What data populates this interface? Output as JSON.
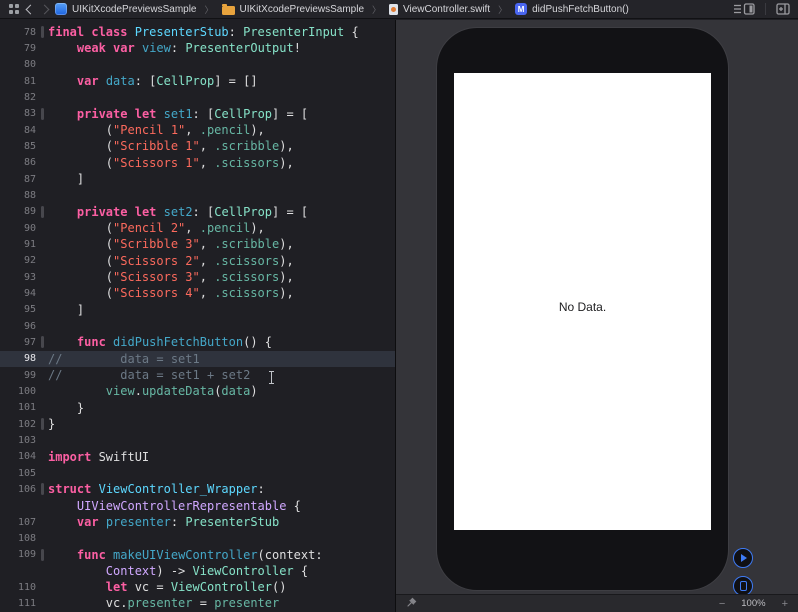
{
  "jump_bar": {
    "breadcrumbs": [
      {
        "label": "UIKitXcodePreviewsSample",
        "icon": "project-icon"
      },
      {
        "label": "UIKitXcodePreviewsSample",
        "icon": "folder-icon"
      },
      {
        "label": "ViewController.swift",
        "icon": "swift-file-icon"
      },
      {
        "label": "didPushFetchButton()",
        "icon": "method-icon",
        "badge": "M"
      }
    ],
    "separator": "〉"
  },
  "editor": {
    "current_line": 98,
    "rows": [
      {
        "n": 78,
        "mark": true,
        "t": [
          [
            "k",
            "final"
          ],
          [
            "p",
            " "
          ],
          [
            "k",
            "class"
          ],
          [
            "p",
            " "
          ],
          [
            "t",
            "PresenterStub"
          ],
          [
            "p",
            ": "
          ],
          [
            "u",
            "PresenterInput"
          ],
          [
            "p",
            " {"
          ]
        ]
      },
      {
        "n": 79,
        "t": [
          [
            "p",
            "    "
          ],
          [
            "k",
            "weak"
          ],
          [
            "p",
            " "
          ],
          [
            "k",
            "var"
          ],
          [
            "p",
            " "
          ],
          [
            "d",
            "view"
          ],
          [
            "p",
            ": "
          ],
          [
            "u",
            "PresenterOutput"
          ],
          [
            "p",
            "!"
          ]
        ]
      },
      {
        "n": 80,
        "t": []
      },
      {
        "n": 81,
        "t": [
          [
            "p",
            "    "
          ],
          [
            "k",
            "var"
          ],
          [
            "p",
            " "
          ],
          [
            "d",
            "data"
          ],
          [
            "p",
            ": ["
          ],
          [
            "u",
            "CellProp"
          ],
          [
            "p",
            "] = []"
          ]
        ]
      },
      {
        "n": 82,
        "t": []
      },
      {
        "n": 83,
        "mark": true,
        "t": [
          [
            "p",
            "    "
          ],
          [
            "k",
            "private"
          ],
          [
            "p",
            " "
          ],
          [
            "k",
            "let"
          ],
          [
            "p",
            " "
          ],
          [
            "d",
            "set1"
          ],
          [
            "p",
            ": ["
          ],
          [
            "u",
            "CellProp"
          ],
          [
            "p",
            "] = ["
          ]
        ]
      },
      {
        "n": 84,
        "t": [
          [
            "p",
            "        ("
          ],
          [
            "s",
            "\"Pencil 1\""
          ],
          [
            "p",
            ", "
          ],
          [
            "m",
            ".pencil"
          ],
          [
            "p",
            "),"
          ]
        ]
      },
      {
        "n": 85,
        "t": [
          [
            "p",
            "        ("
          ],
          [
            "s",
            "\"Scribble 1\""
          ],
          [
            "p",
            ", "
          ],
          [
            "m",
            ".scribble"
          ],
          [
            "p",
            "),"
          ]
        ]
      },
      {
        "n": 86,
        "t": [
          [
            "p",
            "        ("
          ],
          [
            "s",
            "\"Scissors 1\""
          ],
          [
            "p",
            ", "
          ],
          [
            "m",
            ".scissors"
          ],
          [
            "p",
            "),"
          ]
        ]
      },
      {
        "n": 87,
        "t": [
          [
            "p",
            "    ]"
          ]
        ]
      },
      {
        "n": 88,
        "t": []
      },
      {
        "n": 89,
        "mark": true,
        "t": [
          [
            "p",
            "    "
          ],
          [
            "k",
            "private"
          ],
          [
            "p",
            " "
          ],
          [
            "k",
            "let"
          ],
          [
            "p",
            " "
          ],
          [
            "d",
            "set2"
          ],
          [
            "p",
            ": ["
          ],
          [
            "u",
            "CellProp"
          ],
          [
            "p",
            "] = ["
          ]
        ]
      },
      {
        "n": 90,
        "t": [
          [
            "p",
            "        ("
          ],
          [
            "s",
            "\"Pencil 2\""
          ],
          [
            "p",
            ", "
          ],
          [
            "m",
            ".pencil"
          ],
          [
            "p",
            "),"
          ]
        ]
      },
      {
        "n": 91,
        "t": [
          [
            "p",
            "        ("
          ],
          [
            "s",
            "\"Scribble 3\""
          ],
          [
            "p",
            ", "
          ],
          [
            "m",
            ".scribble"
          ],
          [
            "p",
            "),"
          ]
        ]
      },
      {
        "n": 92,
        "t": [
          [
            "p",
            "        ("
          ],
          [
            "s",
            "\"Scissors 2\""
          ],
          [
            "p",
            ", "
          ],
          [
            "m",
            ".scissors"
          ],
          [
            "p",
            "),"
          ]
        ]
      },
      {
        "n": 93,
        "t": [
          [
            "p",
            "        ("
          ],
          [
            "s",
            "\"Scissors 3\""
          ],
          [
            "p",
            ", "
          ],
          [
            "m",
            ".scissors"
          ],
          [
            "p",
            "),"
          ]
        ]
      },
      {
        "n": 94,
        "t": [
          [
            "p",
            "        ("
          ],
          [
            "s",
            "\"Scissors 4\""
          ],
          [
            "p",
            ", "
          ],
          [
            "m",
            ".scissors"
          ],
          [
            "p",
            "),"
          ]
        ]
      },
      {
        "n": 95,
        "t": [
          [
            "p",
            "    ]"
          ]
        ]
      },
      {
        "n": 96,
        "t": []
      },
      {
        "n": 97,
        "mark": true,
        "t": [
          [
            "p",
            "    "
          ],
          [
            "k",
            "func"
          ],
          [
            "p",
            " "
          ],
          [
            "d",
            "didPushFetchButton"
          ],
          [
            "p",
            "() {"
          ]
        ]
      },
      {
        "n": 98,
        "t": [
          [
            "c",
            "//        data = set1"
          ]
        ]
      },
      {
        "n": 99,
        "t": [
          [
            "c",
            "//        data = set1 + set2"
          ]
        ]
      },
      {
        "n": 100,
        "t": [
          [
            "p",
            "        "
          ],
          [
            "m",
            "view"
          ],
          [
            "p",
            "."
          ],
          [
            "m",
            "updateData"
          ],
          [
            "p",
            "("
          ],
          [
            "m",
            "data"
          ],
          [
            "p",
            ")"
          ]
        ]
      },
      {
        "n": 101,
        "t": [
          [
            "p",
            "    }"
          ]
        ]
      },
      {
        "n": 102,
        "mark": true,
        "t": [
          [
            "p",
            "}"
          ]
        ]
      },
      {
        "n": 103,
        "t": []
      },
      {
        "n": 104,
        "t": [
          [
            "k",
            "import"
          ],
          [
            "p",
            " SwiftUI"
          ]
        ]
      },
      {
        "n": 105,
        "t": []
      },
      {
        "n": 106,
        "mark": true,
        "t": [
          [
            "k",
            "struct"
          ],
          [
            "p",
            " "
          ],
          [
            "t",
            "ViewController_Wrapper"
          ],
          [
            "p",
            ":"
          ]
        ]
      },
      {
        "n": null,
        "t": [
          [
            "p",
            "    "
          ],
          [
            "pr",
            "UIViewControllerRepresentable"
          ],
          [
            "p",
            " {"
          ]
        ]
      },
      {
        "n": 107,
        "t": [
          [
            "p",
            "    "
          ],
          [
            "k",
            "var"
          ],
          [
            "p",
            " "
          ],
          [
            "d",
            "presenter"
          ],
          [
            "p",
            ": "
          ],
          [
            "u",
            "PresenterStub"
          ]
        ]
      },
      {
        "n": 108,
        "t": []
      },
      {
        "n": 109,
        "mark": true,
        "t": [
          [
            "p",
            "    "
          ],
          [
            "k",
            "func"
          ],
          [
            "p",
            " "
          ],
          [
            "d",
            "makeUIViewController"
          ],
          [
            "p",
            "(context:"
          ]
        ]
      },
      {
        "n": null,
        "t": [
          [
            "p",
            "        "
          ],
          [
            "pr",
            "Context"
          ],
          [
            "p",
            ") -> "
          ],
          [
            "u",
            "ViewController"
          ],
          [
            "p",
            " {"
          ]
        ]
      },
      {
        "n": 110,
        "t": [
          [
            "p",
            "        "
          ],
          [
            "k",
            "let"
          ],
          [
            "p",
            " vc = "
          ],
          [
            "u",
            "ViewController"
          ],
          [
            "p",
            "()"
          ]
        ]
      },
      {
        "n": 111,
        "t": [
          [
            "p",
            "        vc."
          ],
          [
            "m",
            "presenter"
          ],
          [
            "p",
            " = "
          ],
          [
            "m",
            "presenter"
          ]
        ]
      }
    ]
  },
  "canvas": {
    "device_screen_text": "No Data.",
    "zoom": {
      "minus": "−",
      "level": "100%",
      "plus": "+"
    }
  },
  "colors": {
    "editor_background": "#1f1f24",
    "current_line_highlight": "#2f333d",
    "keyword": "#fc5fa3",
    "string": "#fc6a5d",
    "comment": "#6c7986",
    "type_declaration": "#5dd8ff",
    "type_use": "#86e2c8",
    "member": "#67b7a4",
    "sdk_type": "#d0a8ff",
    "canvas_background": "#343439",
    "preview_accent_blue": "#3e7bf5"
  }
}
